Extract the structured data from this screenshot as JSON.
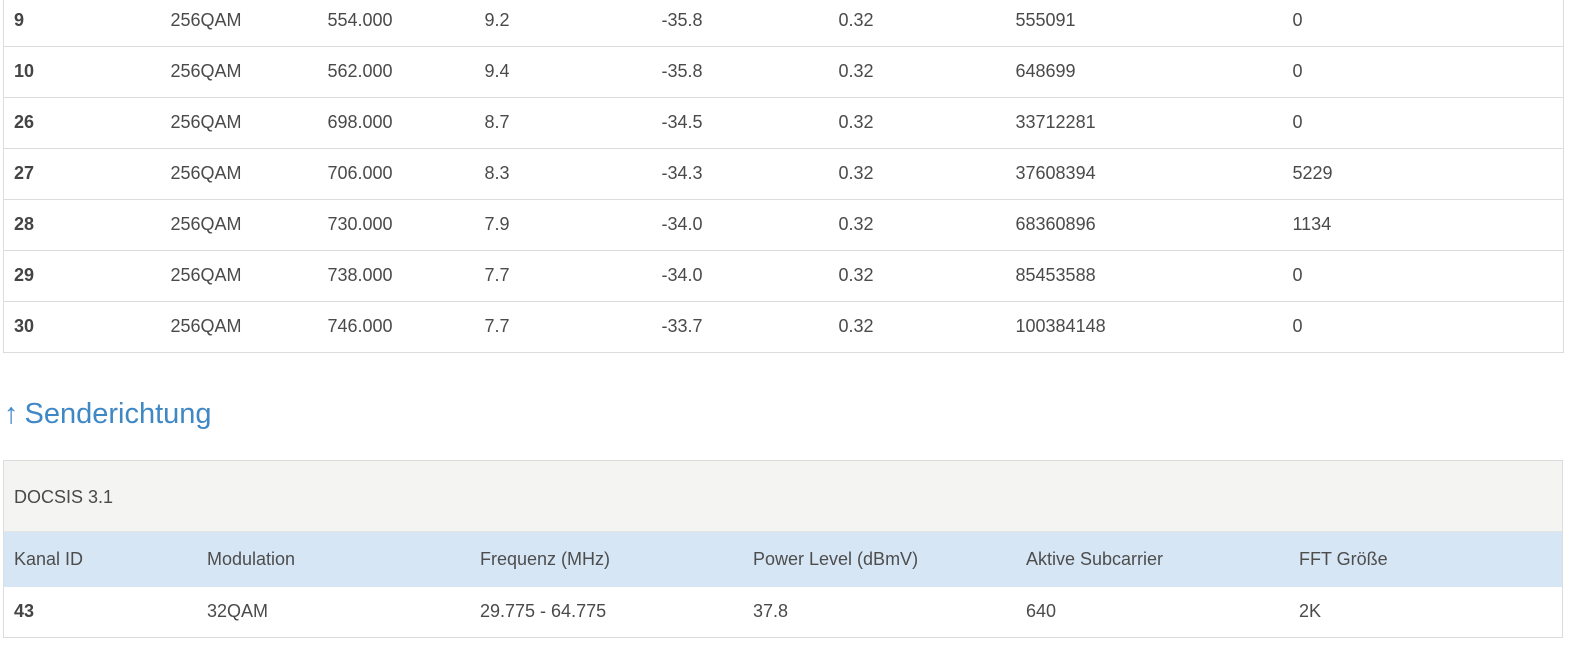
{
  "downstream_rows": [
    [
      "9",
      "256QAM",
      "554.000",
      "9.2",
      "-35.8",
      "0.32",
      "555091",
      "0"
    ],
    [
      "10",
      "256QAM",
      "562.000",
      "9.4",
      "-35.8",
      "0.32",
      "648699",
      "0"
    ],
    [
      "26",
      "256QAM",
      "698.000",
      "8.7",
      "-34.5",
      "0.32",
      "33712281",
      "0"
    ],
    [
      "27",
      "256QAM",
      "706.000",
      "8.3",
      "-34.3",
      "0.32",
      "37608394",
      "5229"
    ],
    [
      "28",
      "256QAM",
      "730.000",
      "7.9",
      "-34.0",
      "0.32",
      "68360896",
      "1134"
    ],
    [
      "29",
      "256QAM",
      "738.000",
      "7.7",
      "-34.0",
      "0.32",
      "85453588",
      "0"
    ],
    [
      "30",
      "256QAM",
      "746.000",
      "7.7",
      "-33.7",
      "0.32",
      "100384148",
      "0"
    ]
  ],
  "upstream": {
    "arrow": "↑",
    "heading": "Senderichtung",
    "caption": "DOCSIS 3.1",
    "headers": [
      "Kanal ID",
      "Modulation",
      "Frequenz (MHz)",
      "Power Level (dBmV)",
      "Aktive Subcarrier",
      "FFT Größe"
    ],
    "rows": [
      [
        "43",
        "32QAM",
        "29.775 - 64.775",
        "37.8",
        "640",
        "2K"
      ]
    ]
  },
  "colors": {
    "heading_blue": "#3f88c5",
    "header_row_bg": "#d6e6f5",
    "caption_bg": "#f4f4f2",
    "border": "#dcdcdc"
  }
}
